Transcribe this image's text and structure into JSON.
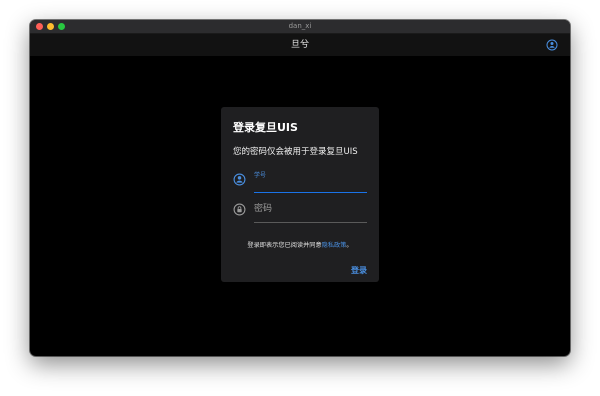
{
  "window": {
    "title": "dan_xi"
  },
  "appbar": {
    "title": "旦兮",
    "action_icon": "account-circle-icon"
  },
  "dialog": {
    "title": "登录复旦UIS",
    "subtitle": "您的密码仅会被用于登录复旦UIS",
    "username": {
      "label": "学号",
      "value": ""
    },
    "password": {
      "placeholder": "密码",
      "value": ""
    },
    "policy": {
      "prefix": "登录即表示您已阅读并同意",
      "link": "隐私政策",
      "suffix": "。"
    },
    "login_label": "登录"
  },
  "colors": {
    "accent": "#4a90e2",
    "background": "#000000",
    "dialog": "#1f1f21"
  }
}
